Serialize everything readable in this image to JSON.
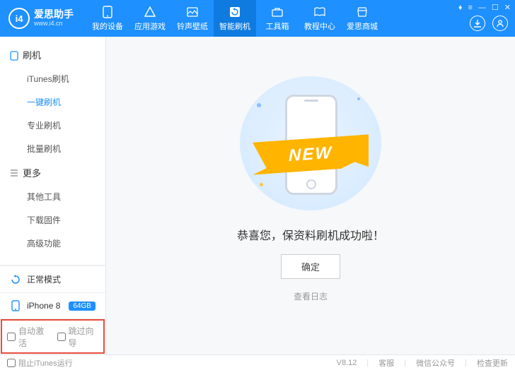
{
  "logo": {
    "badge": "i4",
    "title": "爱思助手",
    "subtitle": "www.i4.cn"
  },
  "nav": [
    {
      "label": "我的设备"
    },
    {
      "label": "应用游戏"
    },
    {
      "label": "铃声壁纸"
    },
    {
      "label": "智能刷机"
    },
    {
      "label": "工具箱"
    },
    {
      "label": "教程中心"
    },
    {
      "label": "爱思商城"
    }
  ],
  "sidebar": {
    "section1": {
      "title": "刷机",
      "items": [
        "iTunes刷机",
        "一键刷机",
        "专业刷机",
        "批量刷机"
      ]
    },
    "section2": {
      "title": "更多",
      "items": [
        "其他工具",
        "下载固件",
        "高级功能"
      ]
    }
  },
  "mode": {
    "label": "正常模式"
  },
  "device": {
    "name": "iPhone 8",
    "storage": "64GB"
  },
  "checks": {
    "auto_activate": "自动激活",
    "skip_guide": "跳过向导",
    "block_itunes": "阻止iTunes运行"
  },
  "main": {
    "ribbon": "NEW",
    "message": "恭喜您，保资料刷机成功啦！",
    "ok": "确定",
    "log": "查看日志"
  },
  "status": {
    "version": "V8.12",
    "support": "客服",
    "wechat": "微信公众号",
    "update": "检查更新"
  }
}
